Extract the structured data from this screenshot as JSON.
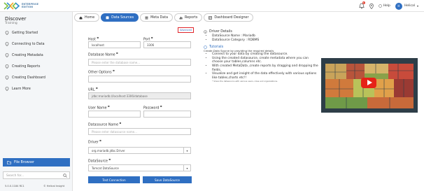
{
  "brand": {
    "line1": "ENTERPRISE",
    "line2": "EDITION"
  },
  "topbar": {
    "notif_count": "1",
    "help": "Help",
    "avatar_initials": "H",
    "user": "Helical"
  },
  "sidebar": {
    "title": "Discover",
    "subtitle": "Training",
    "items": [
      {
        "label": "Getting Started"
      },
      {
        "label": "Connecting to Data"
      },
      {
        "label": "Creating Metadata"
      },
      {
        "label": "Creating Reports"
      },
      {
        "label": "Creating Dashboard"
      },
      {
        "label": "Learn More"
      }
    ],
    "file_browser": "File Browser",
    "search_placeholder": "Search for...",
    "version": "5.0.0.1184 RC1",
    "copyright": "© Helical Insight"
  },
  "tabs": [
    {
      "label": "Home"
    },
    {
      "label": "Data Sources"
    },
    {
      "label": "Meta Data"
    },
    {
      "label": "Reports"
    },
    {
      "label": "Dashboard Designer"
    }
  ],
  "form": {
    "advanced": "Advanced",
    "host_label": "Host",
    "host_value": "localhost",
    "port_label": "Port",
    "port_value": "3306",
    "db_label": "Database Name",
    "db_placeholder": "Please enter the database name...",
    "other_label": "Other Options",
    "other_value": "",
    "url_label": "URL",
    "url_value": "jdbc:mariadb://localhost:3306/database",
    "user_label": "User Name",
    "user_value": "",
    "pass_label": "Password",
    "pass_value": "",
    "ds_label": "Datasource Name",
    "ds_placeholder": "Please enter datasource name...",
    "driver_label": "Driver",
    "driver_value": "org.mariadb.jdbc.Driver",
    "dstype_label": "DataSource",
    "dstype_value": "Tomcat DataSource",
    "test_btn": "Test Connection",
    "save_btn": "Save DataSource"
  },
  "info": {
    "driver_title": "Driver Details",
    "driver_items": [
      "DataSource Name : Mariadb",
      "DataSource Category : RDBMS"
    ],
    "tutorials_title": "Tutorials",
    "tutorials_intro": "Create Data Source by providing the required details",
    "tutorial_items": [
      "Connect to your data by creating the datasource.",
      "Using the created datasource, create metadata where you can choose your tables,columns etc.",
      "With created MetaData ,create reports by dragging and dropping the fields.",
      "Visualize and get insight of the data effectively with various options like tables,charts etc!!"
    ],
    "note": "* Share the datasource with various users, roles and organizations."
  }
}
